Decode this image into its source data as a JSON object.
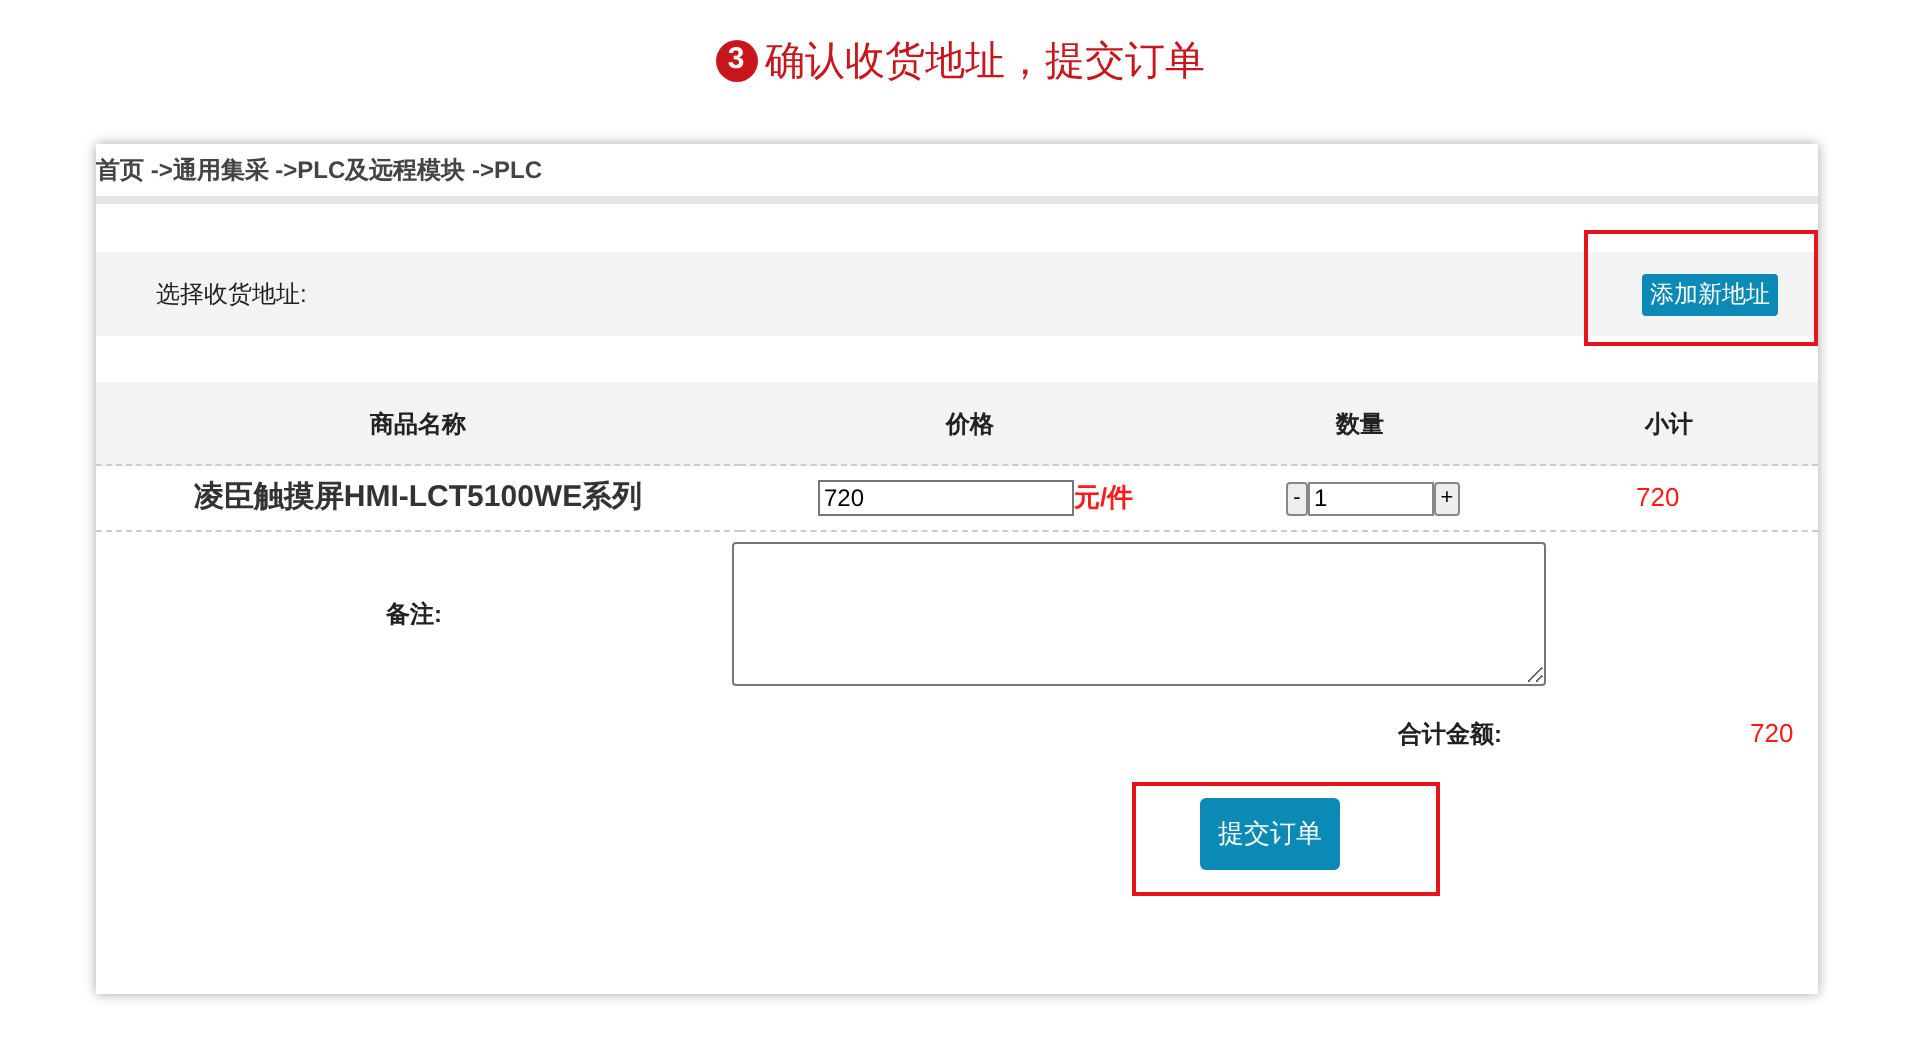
{
  "heading": {
    "step": "3",
    "title": "确认收货地址，提交订单"
  },
  "breadcrumb": "首页 ->通用集采 ->PLC及远程模块 ->PLC",
  "address": {
    "label": "选择收货地址:",
    "add_button": "添加新地址"
  },
  "table": {
    "columns": [
      "商品名称",
      "价格",
      "数量",
      "小计"
    ],
    "rows": [
      {
        "name": "凌臣触摸屏HMI-LCT5100WE系列",
        "price": "720",
        "unit": "元/件",
        "minus": "-",
        "quantity": "1",
        "plus": "+",
        "subtotal": "720"
      }
    ]
  },
  "remark": {
    "label": "备注:"
  },
  "total": {
    "label": "合计金额:",
    "value": "720"
  },
  "submit_button": "提交订单"
}
